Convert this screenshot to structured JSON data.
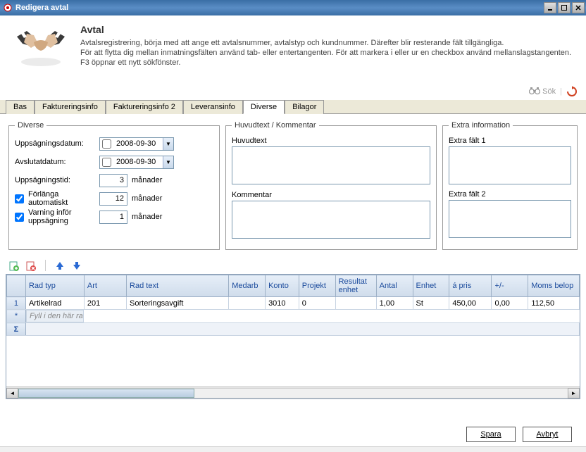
{
  "window": {
    "title": "Redigera avtal"
  },
  "header": {
    "title": "Avtal",
    "line1": "Avtalsregistrering, börja med att ange ett avtalsnummer, avtalstyp och kundnummer. Därefter blir resterande fält tillgängliga.",
    "line2": "För att flytta dig mellan inmatningsfälten använd tab- eller entertangenten. För att markera i eller ur en checkbox använd mellanslagstangenten.",
    "line3": "F3 öppnar ett nytt sökfönster."
  },
  "actions": {
    "search_label": "Sök"
  },
  "tabs": {
    "bas": "Bas",
    "fakt1": "Faktureringsinfo",
    "fakt2": "Faktureringsinfo 2",
    "lev": "Leveransinfo",
    "div": "Diverse",
    "bil": "Bilagor"
  },
  "diverse": {
    "legend": "Diverse",
    "upps_datum_label": "Uppsägningsdatum:",
    "upps_datum_value": "2008-09-30",
    "avslut_datum_label": "Avslutatdatum:",
    "avslut_datum_value": "2008-09-30",
    "upps_tid_label": "Uppsägningstid:",
    "upps_tid_value": "3",
    "unit_months": "månader",
    "forlang_label": "Förlänga automatiskt",
    "forlang_value": "12",
    "varning_label": "Varning inför uppsägning",
    "varning_value": "1"
  },
  "huvud": {
    "legend": "Huvudtext / Kommentar",
    "huvudtext_label": "Huvudtext",
    "kommentar_label": "Kommentar"
  },
  "extra": {
    "legend": "Extra information",
    "falt1_label": "Extra fält 1",
    "falt2_label": "Extra fält 2"
  },
  "grid": {
    "cols": {
      "radtyp": "Rad typ",
      "art": "Art",
      "radtext": "Rad text",
      "medarb": "Medarb",
      "konto": "Konto",
      "projekt": "Projekt",
      "resultat": "Resultat enhet",
      "antal": "Antal",
      "enhet": "Enhet",
      "apris": "á pris",
      "plusminus": "+/-",
      "moms": "Moms belop"
    },
    "rows": [
      {
        "num": "1",
        "radtyp": "Artikelrad",
        "art": "201",
        "radtext": "Sorteringsavgift",
        "medarb": "",
        "konto": "3010",
        "projekt": "0",
        "resultat": "",
        "antal": "1,00",
        "enhet": "St",
        "apris": "450,00",
        "plusminus": "0,00",
        "moms": "112,50"
      }
    ],
    "placeholder": "Fyll i den här raden för att lägga till en ny avtalsrad...",
    "sum_symbol": "Σ",
    "new_symbol": "*"
  },
  "footer": {
    "save": "Spara",
    "cancel": "Avbryt"
  }
}
